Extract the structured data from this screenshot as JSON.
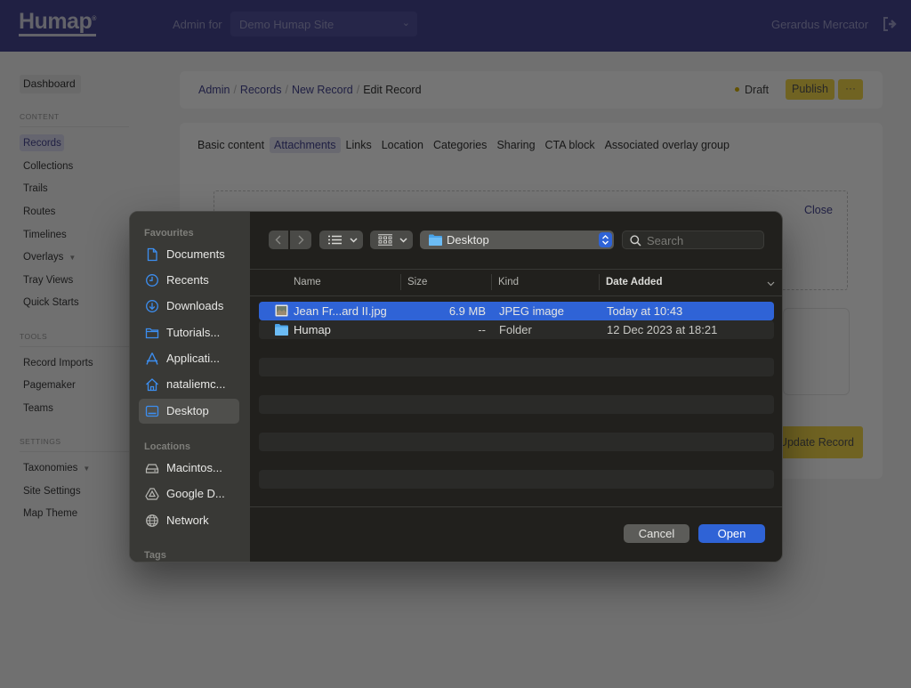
{
  "app": {
    "logo": "Humap",
    "admin_for_label": "Admin for",
    "site_select_value": "Demo Humap Site",
    "user_name": "Gerardus Mercator"
  },
  "sidebar": {
    "dashboard": "Dashboard",
    "sections": [
      {
        "title": "CONTENT",
        "items": [
          "Records",
          "Collections",
          "Trails",
          "Routes",
          "Timelines",
          "Overlays",
          "Tray Views",
          "Quick Starts"
        ]
      },
      {
        "title": "TOOLS",
        "items": [
          "Record Imports",
          "Pagemaker",
          "Teams"
        ]
      },
      {
        "title": "SETTINGS",
        "items": [
          "Taxonomies",
          "Site Settings",
          "Map Theme"
        ]
      }
    ],
    "active_item": "Records"
  },
  "breadcrumb": [
    "Admin",
    "Records",
    "New Record",
    "Edit Record"
  ],
  "status": {
    "label": "Draft",
    "color": "#d7b400"
  },
  "actions": {
    "publish": "Publish",
    "more": "···",
    "update": "Update Record",
    "close": "Close"
  },
  "tabs": [
    "Basic content",
    "Attachments",
    "Links",
    "Location",
    "Categories",
    "Sharing",
    "CTA block",
    "Associated overlay group"
  ],
  "active_tab": "Attachments",
  "dialog": {
    "favourites_title": "Favourites",
    "favourites": [
      {
        "label": "Documents",
        "icon": "document-icon"
      },
      {
        "label": "Recents",
        "icon": "clock-icon"
      },
      {
        "label": "Downloads",
        "icon": "download-icon"
      },
      {
        "label": "Tutorials...",
        "icon": "folder-icon"
      },
      {
        "label": "Applicati...",
        "icon": "applications-icon"
      },
      {
        "label": "nataliemc...",
        "icon": "home-icon"
      },
      {
        "label": "Desktop",
        "icon": "desktop-icon",
        "selected": true
      }
    ],
    "locations_title": "Locations",
    "locations": [
      {
        "label": "Macintos...",
        "icon": "drive-icon"
      },
      {
        "label": "Google D...",
        "icon": "google-drive-icon"
      },
      {
        "label": "Network",
        "icon": "network-icon"
      }
    ],
    "tags_title": "Tags",
    "current_folder": "Desktop",
    "search_placeholder": "Search",
    "columns": [
      "Name",
      "Size",
      "Kind",
      "Date Added"
    ],
    "files": [
      {
        "name": "Jean Fr...ard II.jpg",
        "size": "6.9 MB",
        "kind": "JPEG image",
        "date_added": "Today at 10:43",
        "type": "image",
        "selected": true
      },
      {
        "name": "Humap",
        "size": "--",
        "kind": "Folder",
        "date_added": "12 Dec 2023 at 18:21",
        "type": "folder"
      }
    ],
    "cancel": "Cancel",
    "open": "Open",
    "accent": "#2f63d6"
  }
}
